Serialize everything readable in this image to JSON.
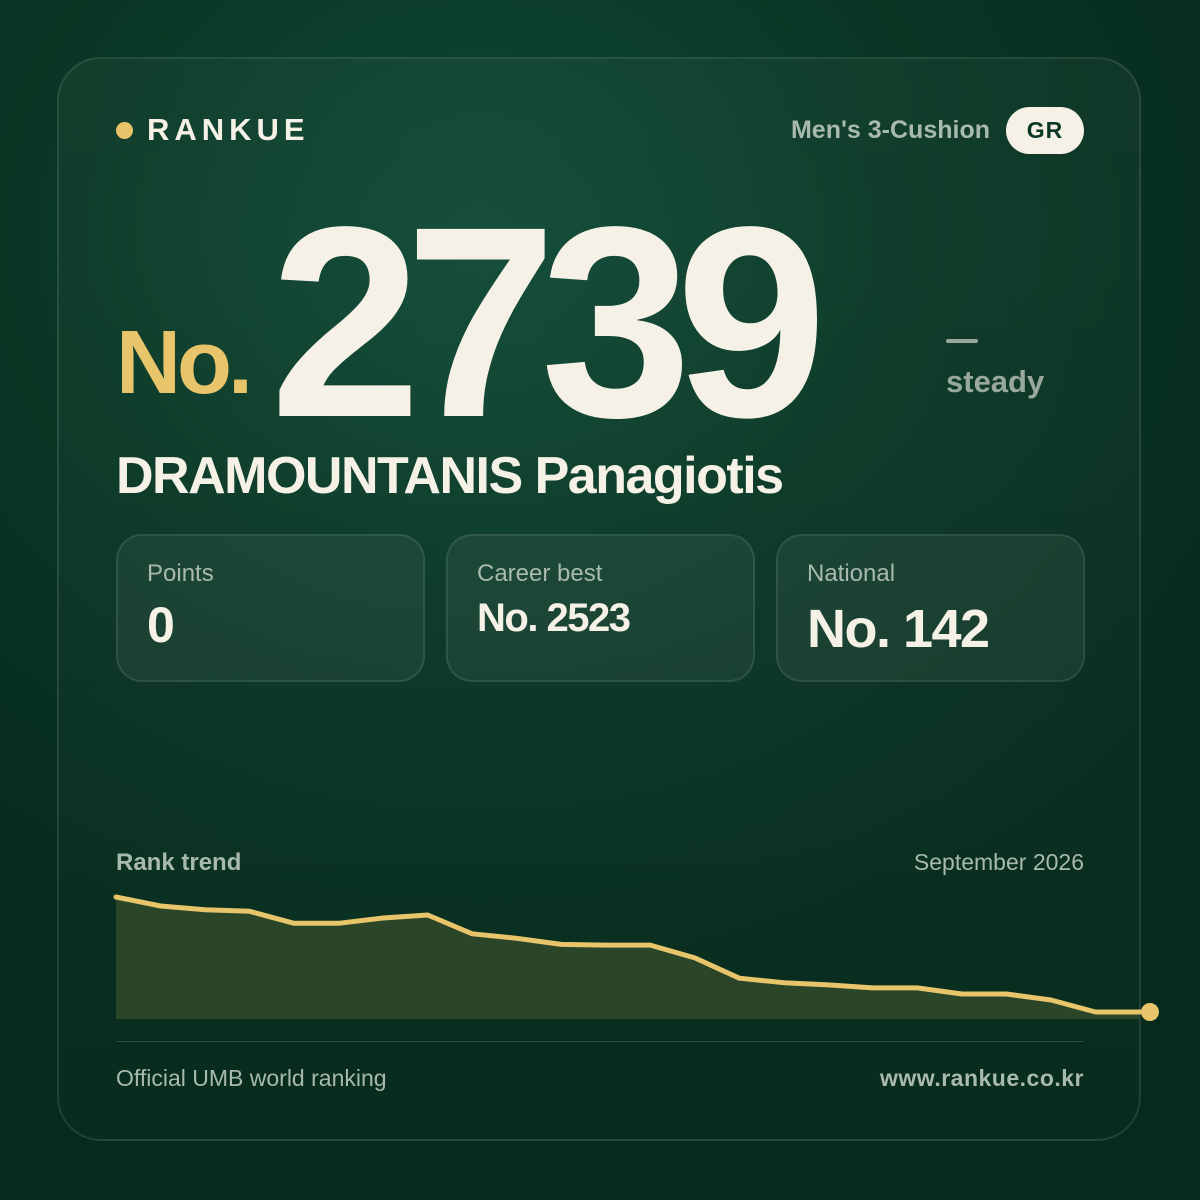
{
  "brand": {
    "name": "RANKUE"
  },
  "header": {
    "category": "Men's 3-Cushion",
    "country_code": "GR"
  },
  "rank": {
    "prefix": "No.",
    "value": "2739",
    "trend_symbol": "—",
    "trend_label": "steady"
  },
  "player": {
    "name": "DRAMOUNTANIS Panagiotis"
  },
  "stats": [
    {
      "label": "Points",
      "value": "0"
    },
    {
      "label": "Career best",
      "value": "No. 2523"
    },
    {
      "label": "National",
      "value": "No. 142"
    }
  ],
  "chart": {
    "title": "Rank trend",
    "date_label": "September 2026"
  },
  "chart_data": {
    "type": "area",
    "title": "Rank trend",
    "x": [
      1,
      2,
      3,
      4,
      5,
      6,
      7,
      8,
      9,
      10,
      11,
      12,
      13,
      14,
      15,
      16,
      17,
      18,
      19,
      20,
      21,
      22,
      23,
      24
    ],
    "values": [
      2560,
      2572,
      2577,
      2579,
      2595,
      2595,
      2588,
      2584,
      2609,
      2615,
      2623,
      2624,
      2624,
      2641,
      2668,
      2674,
      2677,
      2681,
      2681,
      2689,
      2689,
      2697,
      2713,
      2713
    ],
    "final_value": 2739,
    "y_inverted": true,
    "series_color": "#e8c46a",
    "fill_color": "#2a4528"
  },
  "footer": {
    "left": "Official UMB world ranking",
    "right": "www.rankue.co.kr"
  },
  "colors": {
    "accent": "#e8c46a",
    "text": "#f5f1e6",
    "muted": "#a8b9ae",
    "background": "#0a3826"
  }
}
